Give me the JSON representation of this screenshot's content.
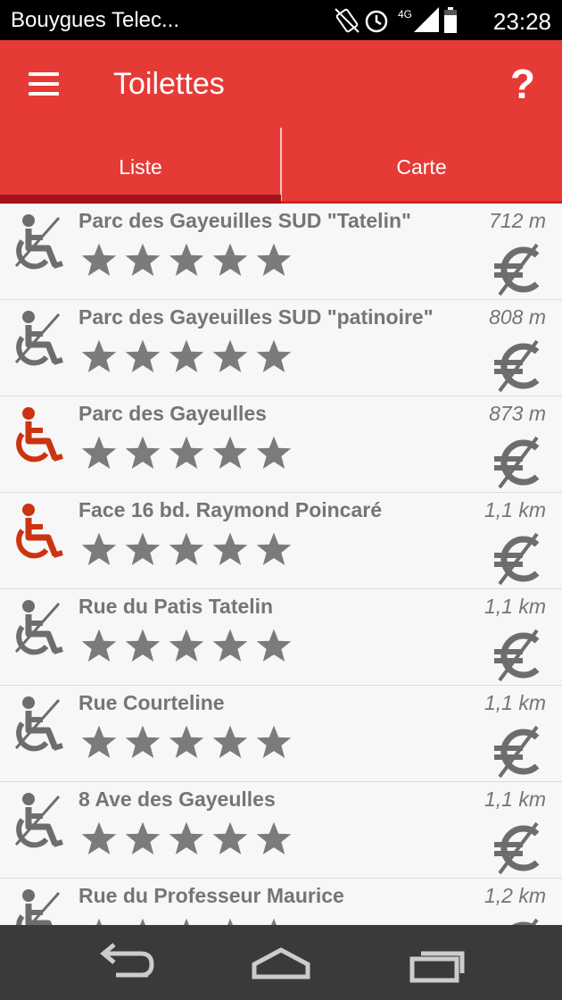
{
  "status_bar": {
    "carrier": "Bouygues Telec...",
    "network": "4G",
    "time": "23:28"
  },
  "app_bar": {
    "title": "Toilettes",
    "help_label": "?"
  },
  "tabs": [
    {
      "label": "Liste",
      "selected": true
    },
    {
      "label": "Carte",
      "selected": false
    }
  ],
  "colors": {
    "primary": "#e63a37",
    "tab_indicator": "#a4141a",
    "text_gray": "#757575",
    "accessible_red": "#cc3311",
    "icon_gray": "#6d6d6d"
  },
  "rating_max": 5,
  "items": [
    {
      "name": "Parc des Gayeuilles SUD \"Tatelin\"",
      "distance": "712 m",
      "accessible": false,
      "rating": 0,
      "free": true
    },
    {
      "name": "Parc des Gayeuilles SUD \"patinoire\"",
      "distance": "808 m",
      "accessible": false,
      "rating": 0,
      "free": true
    },
    {
      "name": "Parc des Gayeulles",
      "distance": "873 m",
      "accessible": true,
      "rating": 0,
      "free": true
    },
    {
      "name": "Face 16 bd. Raymond Poincaré",
      "distance": "1,1 km",
      "accessible": true,
      "rating": 0,
      "free": true
    },
    {
      "name": "Rue du Patis Tatelin",
      "distance": "1,1 km",
      "accessible": false,
      "rating": 0,
      "free": true
    },
    {
      "name": "Rue Courteline",
      "distance": "1,1 km",
      "accessible": false,
      "rating": 0,
      "free": true
    },
    {
      "name": "8 Ave des Gayeulles",
      "distance": "1,1 km",
      "accessible": false,
      "rating": 0,
      "free": true
    },
    {
      "name": "Rue du Professeur Maurice",
      "distance": "1,2 km",
      "accessible": false,
      "rating": 0,
      "free": true
    }
  ],
  "nav_bar": {
    "buttons": [
      "back-icon",
      "home-icon",
      "recent-apps-icon"
    ]
  }
}
